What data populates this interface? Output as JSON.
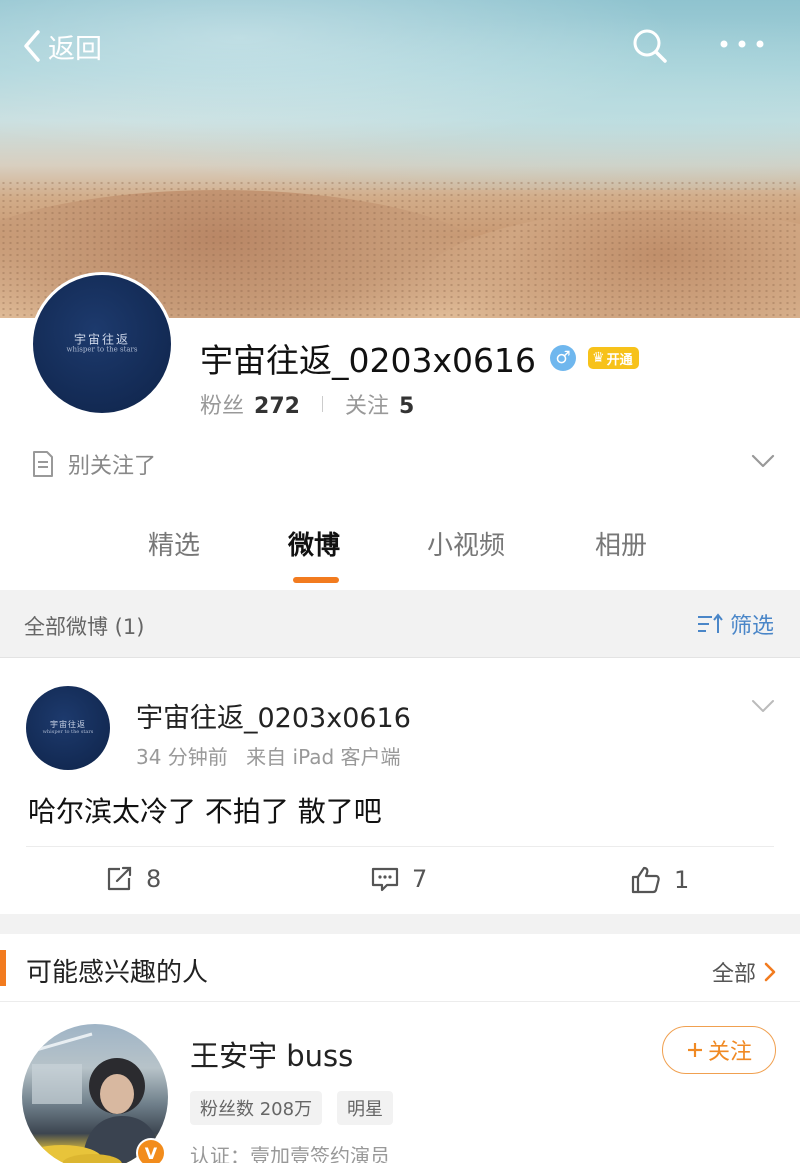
{
  "nav": {
    "back_label": "返回"
  },
  "profile": {
    "username": "宇宙往返_0203x0616",
    "gender": "♂",
    "vip_label": "开通",
    "followers_label": "粉丝",
    "followers_count": "272",
    "following_label": "关注",
    "following_count": "5",
    "intro": "别关注了",
    "avatar_text": "宇宙往返",
    "avatar_subtext": "whisper to the stars"
  },
  "tabs": [
    "精选",
    "微博",
    "小视频",
    "相册"
  ],
  "active_tab": "微博",
  "filter": {
    "count_label": "全部微博 (1)",
    "filter_label": "筛选"
  },
  "post": {
    "author": "宇宙往返_0203x0616",
    "time": "34 分钟前",
    "source": "来自 iPad 客户端",
    "text": "哈尔滨太冷了 不拍了 散了吧",
    "reposts": "8",
    "comments": "7",
    "likes": "1"
  },
  "recommend": {
    "title": "可能感兴趣的人",
    "all_label": "全部",
    "user": {
      "name": "王安宇 buss",
      "tags": [
        "粉丝数 208万",
        "明星"
      ],
      "verify": "认证：壹加壹签约演员",
      "follow_label": "关注",
      "badge": "V"
    }
  },
  "colors": {
    "accent": "#f27b1f",
    "link": "#4a86c8",
    "gender": "#6fb7ee",
    "vip": "#f7c21a"
  }
}
